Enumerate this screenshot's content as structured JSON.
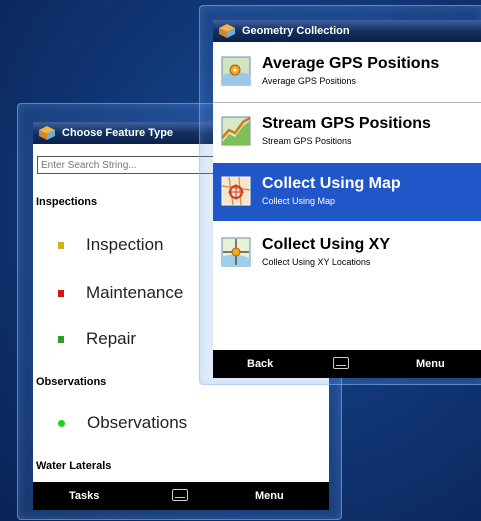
{
  "feature_window": {
    "title": "Choose Feature Type",
    "search_placeholder": "Enter Search String...",
    "sections": [
      {
        "label": "Inspections"
      },
      {
        "label": "Observations"
      },
      {
        "label": "Water Laterals"
      }
    ],
    "items": [
      {
        "label": "Inspection",
        "color": "#c9b226"
      },
      {
        "label": "Maintenance",
        "color": "#d01515"
      },
      {
        "label": "Repair",
        "color": "#2e9b2e"
      },
      {
        "label": "Observations",
        "color": "#1ed11e"
      }
    ],
    "softkeys": {
      "left": "Tasks",
      "right": "Menu"
    }
  },
  "geometry_window": {
    "title": "Geometry Collection",
    "options": [
      {
        "title": "Average GPS Positions",
        "subtitle": "Average GPS Positions",
        "icon": "gps-average-icon",
        "selected": false
      },
      {
        "title": "Stream GPS Positions",
        "subtitle": "Stream GPS Positions",
        "icon": "gps-stream-icon",
        "selected": false
      },
      {
        "title": "Collect Using Map",
        "subtitle": "Collect Using Map",
        "icon": "map-collect-icon",
        "selected": true
      },
      {
        "title": "Collect Using XY",
        "subtitle": "Collect Using XY Locations",
        "icon": "xy-collect-icon",
        "selected": false
      }
    ],
    "softkeys": {
      "left": "Back",
      "right": "Menu"
    }
  },
  "colors": {
    "selection": "#2156c9",
    "titlebar": "#13305f",
    "background": "#123a7c"
  }
}
